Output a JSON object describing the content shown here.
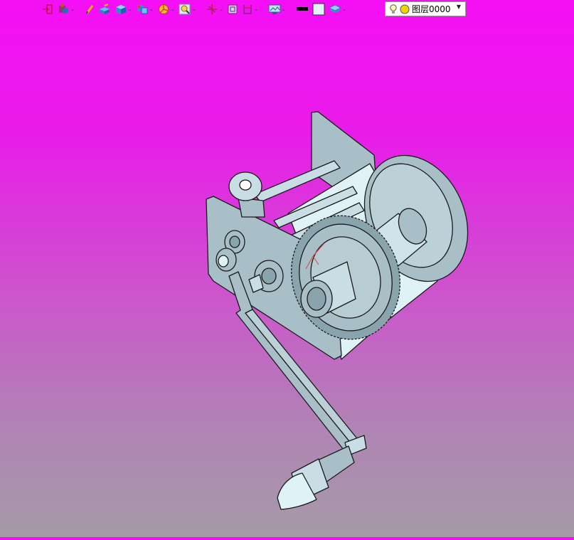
{
  "toolbar": {
    "buttons": [
      {
        "icon": "import-icon",
        "dropdown": false
      },
      {
        "icon": "paint-icon",
        "dropdown": true
      },
      {
        "icon": "pencil-icon",
        "dropdown": false
      },
      {
        "icon": "box-pencil-icon",
        "dropdown": false
      },
      {
        "icon": "cube-icon",
        "dropdown": true
      },
      {
        "icon": "copy-cube-icon",
        "dropdown": true
      },
      {
        "icon": "pie-icon",
        "dropdown": true
      },
      {
        "icon": "zoom-icon",
        "dropdown": true
      },
      {
        "icon": "axis-icon",
        "dropdown": true
      },
      {
        "icon": "frame-icon",
        "dropdown": false
      },
      {
        "icon": "section-icon",
        "dropdown": true
      },
      {
        "icon": "display-icon",
        "dropdown": true
      },
      {
        "icon": "line-color-icon",
        "dropdown": false
      },
      {
        "icon": "fill-color-icon",
        "dropdown": false
      },
      {
        "icon": "layer-stack-icon",
        "dropdown": true
      }
    ],
    "dropdown_glyph": "⌄",
    "layer_select": {
      "value": "图层0000",
      "arrow": "▼"
    }
  },
  "colors": {
    "background_top": "#f50ff5",
    "background_bottom": "#a59aa8",
    "model_fill": "#a9bfc8",
    "model_light": "#dff3f7",
    "model_stroke": "#1a1a1a"
  }
}
